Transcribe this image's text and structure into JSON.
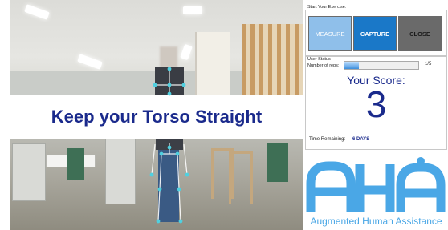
{
  "banner": {
    "instruction": "Keep your Torso Straight"
  },
  "exercise": {
    "title": "Start Your Exercise:",
    "buttons": {
      "measure": "MEASURE",
      "capture": "CAPTURE",
      "close": "CLOSE"
    }
  },
  "status": {
    "title": "User Status",
    "reps_label": "Number of reps:",
    "reps_progress": 0.2,
    "reps_value": "1/5",
    "score_label": "Your Score:",
    "score_value": "3",
    "time_label": "Time Remaining:",
    "time_value": "6 DAYS"
  },
  "logo": {
    "wordmark": "AHA",
    "tagline": "Augmented Human Assistance"
  },
  "colors": {
    "banner_text": "#1a2a8c",
    "measure": "#8fbfea",
    "capture": "#1a78c8",
    "close": "#6a6a6a",
    "logo": "#4aa7e6",
    "skeleton": "#4fd0e0"
  }
}
